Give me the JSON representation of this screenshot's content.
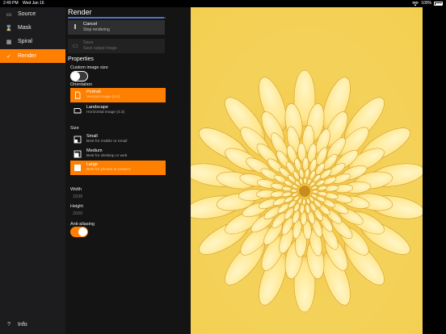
{
  "status_bar": {
    "time": "2:49 PM",
    "date": "Wed Jan 16",
    "battery": "100%"
  },
  "sidebar": {
    "items": [
      {
        "label": "Source",
        "icon": "source-icon",
        "glyph": "▭"
      },
      {
        "label": "Mask",
        "icon": "mask-icon",
        "glyph": "⌛"
      },
      {
        "label": "Spiral",
        "icon": "spiral-icon",
        "glyph": "▦"
      },
      {
        "label": "Render",
        "icon": "checkmark-icon",
        "glyph": "✓",
        "active": true
      }
    ],
    "info": {
      "label": "Info",
      "glyph": "?"
    }
  },
  "panel": {
    "title": "Render",
    "progress": 0.98,
    "cancel": {
      "label": "Cancel",
      "sublabel": "Stop rendering",
      "glyph": "‖"
    },
    "save": {
      "label": "Save",
      "sublabel": "Save output image",
      "glyph": "▭"
    },
    "properties_title": "Properties",
    "custom_size_label": "Custom image size",
    "custom_size_on": false,
    "orientation_label": "Orientation",
    "orientation_options": [
      {
        "label": "Portrait",
        "sublabel": "Vertical image (3:4)",
        "selected": true
      },
      {
        "label": "Landscape",
        "sublabel": "Horizontal image (4:3)",
        "selected": false
      }
    ],
    "size_label": "Size",
    "size_options": [
      {
        "label": "Small",
        "sublabel": "Best for mobile or email",
        "selected": false
      },
      {
        "label": "Medium",
        "sublabel": "Best for desktop or web",
        "selected": false
      },
      {
        "label": "Large",
        "sublabel": "Best for photos or posters",
        "selected": true
      }
    ],
    "width_label": "Width",
    "width_value": "1838",
    "height_label": "Height",
    "height_value": "2600",
    "antialiasing_label": "Anti-aliasing",
    "antialiasing_on": true
  },
  "preview": {
    "description_colors": {
      "petal": "#ffe79a",
      "center": "#f2a81c",
      "shadow": "#b7791a"
    }
  },
  "colors": {
    "accent": "#ff7f00",
    "sidebar_bg": "#1c1c1e",
    "panel_bg": "#141414"
  }
}
